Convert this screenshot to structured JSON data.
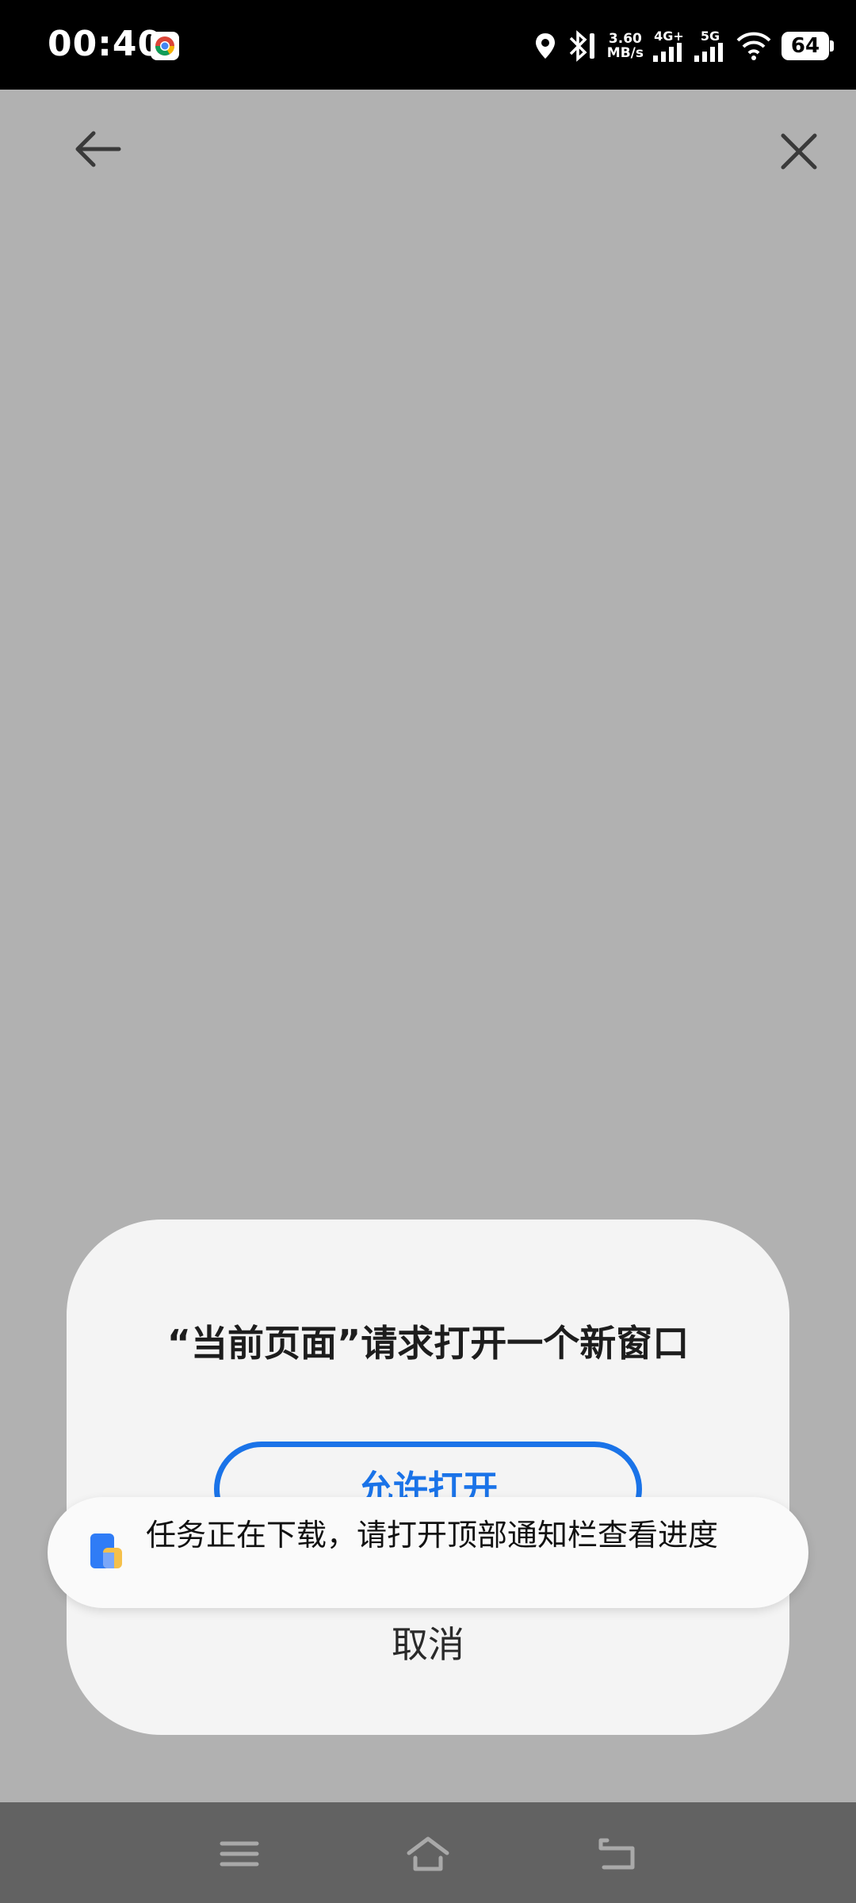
{
  "status_bar": {
    "time": "00:40",
    "speed_value": "3.60",
    "speed_unit": "MB/s",
    "network_1": "4G+",
    "network_2": "5G",
    "battery": "64"
  },
  "dialog": {
    "title": "“当前页面”请求打开一个新窗口",
    "allow_label": "允许打开",
    "cancel_label": "取消"
  },
  "toast": {
    "text": "任务正在下载，请打开顶部通知栏查看进度"
  },
  "colors": {
    "accent": "#1a73e8",
    "scrim": "#b1b1b1"
  },
  "icons": {
    "back": "arrow-left-icon",
    "close": "close-icon",
    "menu": "menu-icon",
    "home": "home-icon",
    "return": "return-icon"
  }
}
